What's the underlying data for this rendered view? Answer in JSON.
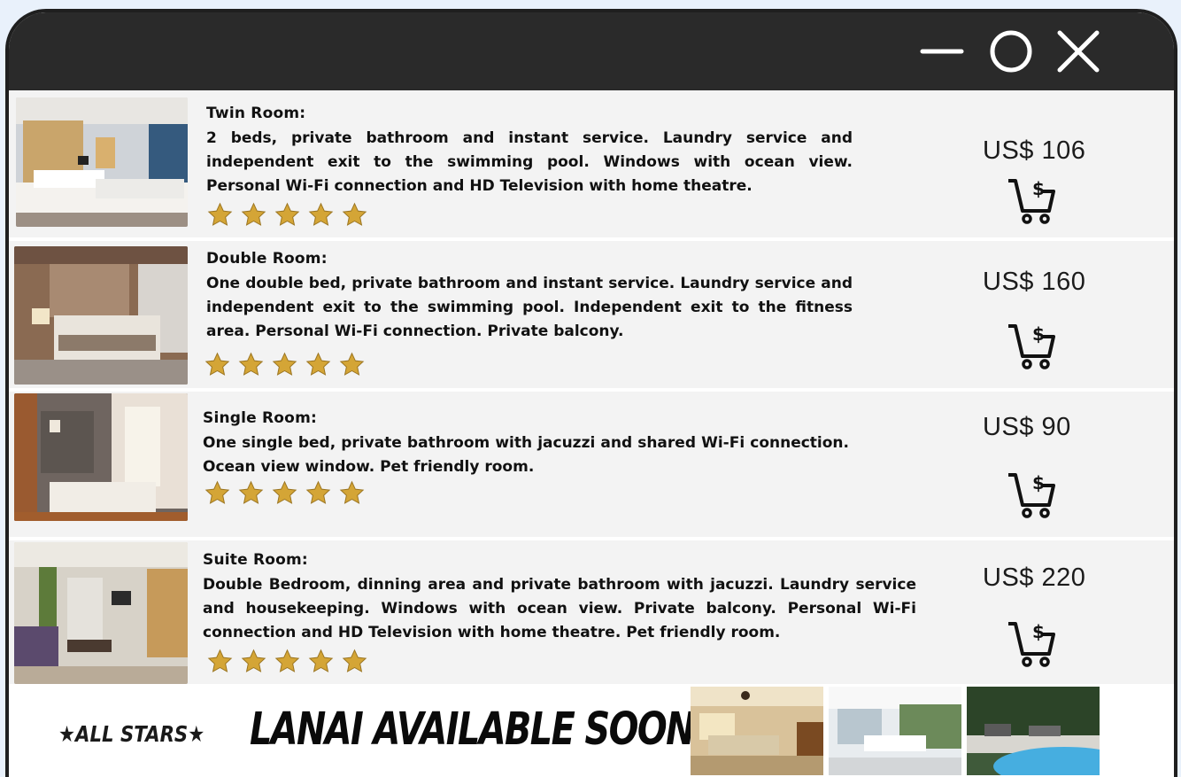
{
  "window": {
    "controls": {
      "minimize_icon": "minimize-icon",
      "maximize_icon": "maximize-icon",
      "close_icon": "close-icon"
    }
  },
  "rooms": [
    {
      "title": "Twin Room:",
      "description": "2 beds, private bathroom and instant service. Laundry service and independent exit to the swimming pool. Windows with ocean view. Personal Wi-Fi connection and HD Television with home theatre.",
      "rating": 5,
      "price": "US$ 106"
    },
    {
      "title": "Double Room:",
      "description": "One double bed, private bathroom and instant service. Laundry service and independent exit to the swimming pool. Independent exit to the fitness area. Personal Wi-Fi connection. Private balcony.",
      "rating": 5,
      "price": "US$ 160"
    },
    {
      "title": "Single  Room:",
      "description": "One single bed, private bathroom with jacuzzi  and shared  Wi-Fi connection. Ocean view window. Pet friendly room.",
      "rating": 5,
      "price": "US$ 90"
    },
    {
      "title": "Suite Room:",
      "description": "Double Bedroom, dinning area and private bathroom with jacuzzi. Laundry service and housekeeping. Windows with ocean view. Private balcony. Personal Wi-Fi connection and HD Television with home theatre. Pet friendly room.",
      "rating": 5,
      "price": "US$ 220"
    }
  ],
  "footer": {
    "brand": "★ALL STARS★",
    "promo": "LANAI AVAILABLE SOON!"
  },
  "colors": {
    "titlebar": "#2a2a2a",
    "row_background": "#f3f3f3",
    "star_gold": "#d4a536"
  },
  "icons": {
    "cart": "cart-dollar-icon",
    "star": "star-icon"
  }
}
